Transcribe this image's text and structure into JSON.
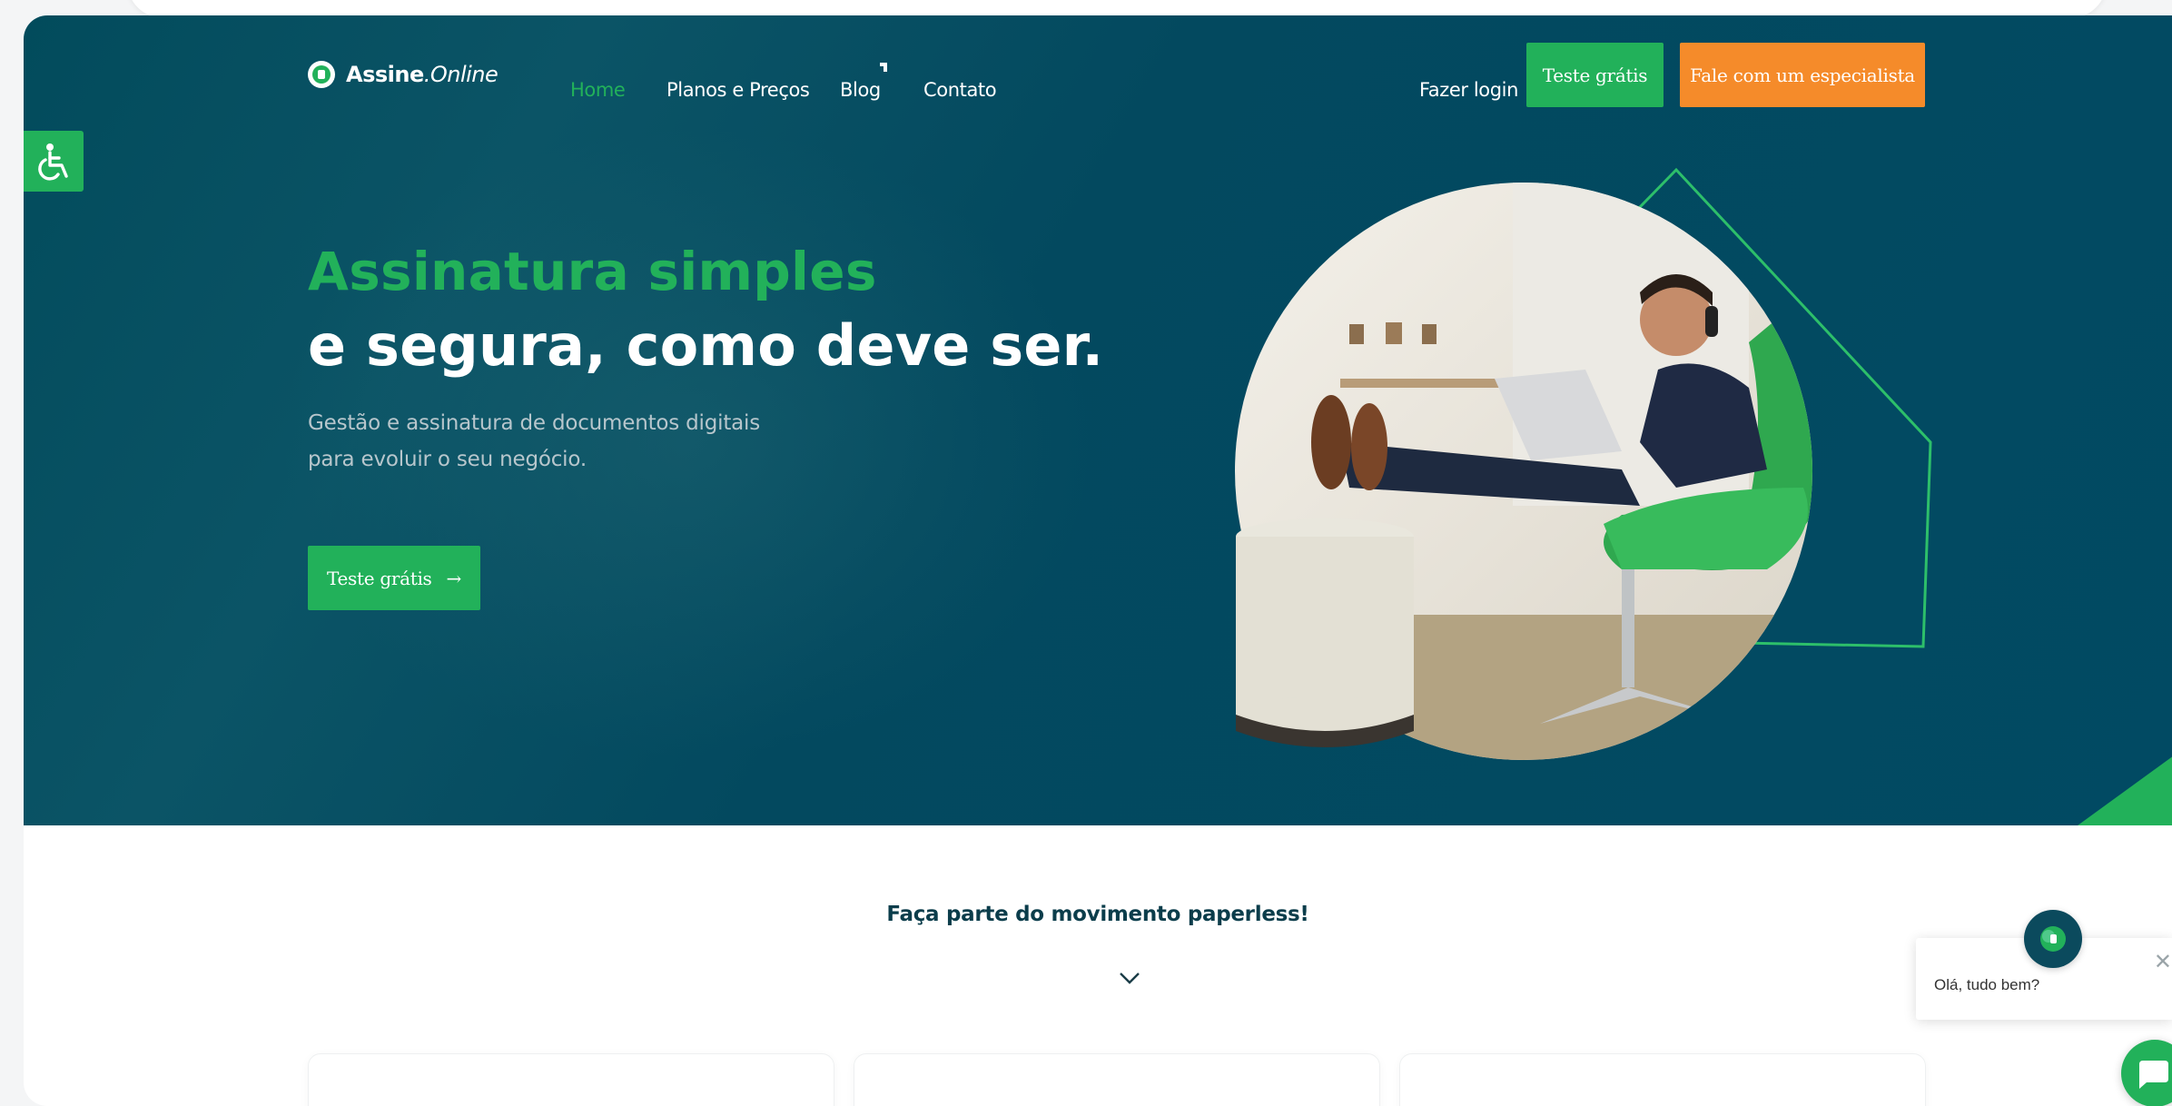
{
  "nav": {
    "logo_bold": "Assine",
    "logo_italic": ".Online",
    "links": [
      {
        "label": "Home",
        "active": true
      },
      {
        "label": "Planos e Preços",
        "active": false
      },
      {
        "label": "Blog",
        "active": false
      },
      {
        "label": "Contato",
        "active": false
      }
    ],
    "login_label": "Fazer login",
    "trial_label": "Teste grátis",
    "expert_label": "Fale com um especialista"
  },
  "hero": {
    "headline_green": "Assinatura simples",
    "headline_white": "e segura, como deve ser.",
    "subtitle_line1": "Gestão e assinatura de documentos digitais",
    "subtitle_line2": "para evoluir o seu negócio.",
    "cta_label": "Teste grátis",
    "cta_arrow": "→"
  },
  "section": {
    "paperless_title": "Faça parte do movimento paperless!"
  },
  "chat": {
    "greeting": "Olá, tudo bem?",
    "close_glyph": "✕"
  },
  "colors": {
    "brand_green": "#22b15a",
    "brand_orange": "#f58b2a",
    "hero_bg": "#024b5c"
  },
  "icons": [
    "accessibility-icon",
    "logo-icon",
    "arrow-right-icon",
    "chevron-down-icon",
    "chat-icon",
    "close-icon"
  ]
}
